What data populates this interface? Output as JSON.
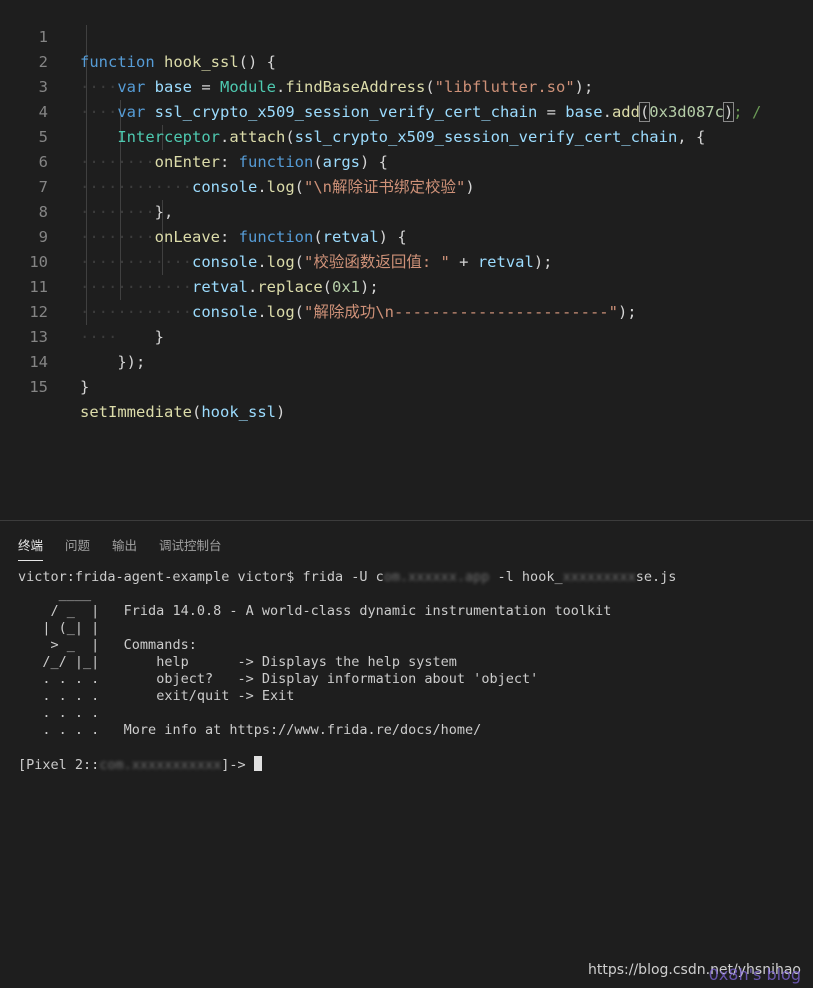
{
  "editor": {
    "lines": [
      {
        "n": "1"
      },
      {
        "n": "2"
      },
      {
        "n": "3"
      },
      {
        "n": "4"
      },
      {
        "n": "5"
      },
      {
        "n": "6"
      },
      {
        "n": "7"
      },
      {
        "n": "8"
      },
      {
        "n": "9"
      },
      {
        "n": "10"
      },
      {
        "n": "11"
      },
      {
        "n": "12"
      },
      {
        "n": "13"
      },
      {
        "n": "14"
      },
      {
        "n": "15"
      }
    ],
    "tokens": {
      "function": "function",
      "hook_ssl": "hook_ssl",
      "var": "var",
      "base": "base",
      "Module": "Module",
      "findBaseAddress": "findBaseAddress",
      "libflutter": "\"libflutter.so\"",
      "ssl_fn": "ssl_crypto_x509_session_verify_cert_chain",
      "add": "add",
      "offset": "0x3d087c",
      "comment_tail": "; /",
      "Interceptor": "Interceptor",
      "attach": "attach",
      "onEnter": "onEnter",
      "args": "args",
      "console": "console",
      "log": "log",
      "str_enter": "\"\\n解除证书绑定校验\"",
      "onLeave": "onLeave",
      "retval": "retval",
      "str_ret": "\"校验函数返回值: \"",
      "replace": "replace",
      "hex1": "0x1",
      "str_done": "\"解除成功\\n-----------------------\"",
      "setImmediate": "setImmediate"
    }
  },
  "panel": {
    "tabs": [
      "终端",
      "问题",
      "输出",
      "调试控制台"
    ],
    "active_tab": "终端"
  },
  "terminal": {
    "prompt_user": "victor:frida-agent-example victor$",
    "cmd_prefix": " frida -U c",
    "cmd_blur1": "om.xxxxxx.app",
    "cmd_mid": " -l hook_",
    "cmd_blur2": "xxxxxxxxx",
    "cmd_suffix": "se.js",
    "banner_title": "Frida 14.0.8 - A world-class dynamic instrumentation toolkit",
    "commands_label": "Commands:",
    "help_cmd": "help",
    "help_desc": "-> Displays the help system",
    "object_cmd": "object?",
    "object_desc": "-> Display information about 'object'",
    "exit_cmd": "exit/quit",
    "exit_desc": "-> Exit",
    "more_info": "More info at https://www.frida.re/docs/home/",
    "session_prefix": "[Pixel 2::",
    "session_blur": "com.xxxxxxxxxxx",
    "session_suffix": "]-> "
  },
  "watermark": {
    "url": "https://blog.csdn.net/yhsnihao",
    "overlay": "0x8h's blog"
  }
}
